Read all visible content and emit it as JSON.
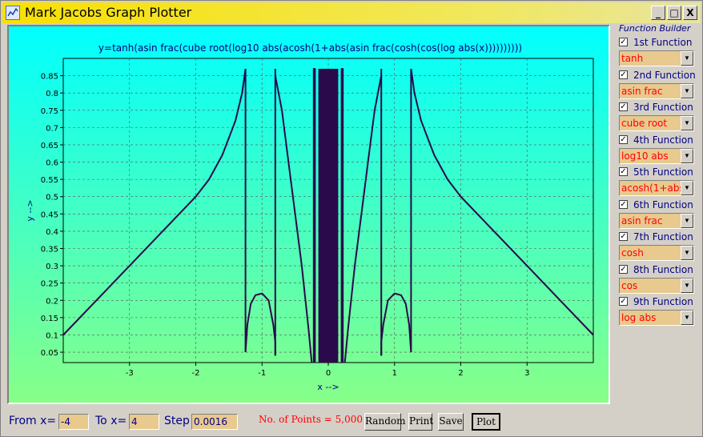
{
  "window": {
    "title": "Mark Jacobs Graph Plotter",
    "minimize": "_",
    "maximize": "□",
    "close": "X"
  },
  "plot": {
    "title": "y=tanh(asin frac(cube root(log10 abs(acosh(1+abs(asin frac(cosh(cos(log abs(x))))))))))"
  },
  "chart_data": {
    "type": "line",
    "title": "y=tanh(asin frac(cube root(log10 abs(acosh(1+abs(asin frac(cosh(cos(log abs(x))))))))))",
    "xlabel": "x -->",
    "ylabel": "y -->",
    "xlim": [
      -4,
      4
    ],
    "ylim": [
      0.02,
      0.9
    ],
    "x_ticks": [
      "-3",
      "-2",
      "-1",
      "0",
      "1",
      "2",
      "3"
    ],
    "y_ticks": [
      "0.05",
      "0.1",
      "0.15",
      "0.2",
      "0.25",
      "0.3",
      "0.35",
      "0.4",
      "0.45",
      "0.5",
      "0.55",
      "0.6",
      "0.65",
      "0.7",
      "0.75",
      "0.8",
      "0.85"
    ],
    "grid": true,
    "line_color": "#2a0a4a",
    "series": [
      {
        "x": [
          -4,
          -3.5,
          -3,
          -2.5,
          -2,
          -1.8,
          -1.6,
          -1.5,
          -1.4,
          -1.3,
          -1.25
        ],
        "y": [
          0.1,
          0.2,
          0.3,
          0.4,
          0.5,
          0.55,
          0.62,
          0.67,
          0.72,
          0.8,
          0.87
        ]
      },
      {
        "x": [
          -1.25,
          -1.25
        ],
        "y": [
          0.87,
          0.05
        ]
      },
      {
        "x": [
          -1.25,
          -1.22,
          -1.17,
          -1.1,
          -1.0,
          -0.9,
          -0.83,
          -0.8,
          -0.8
        ],
        "y": [
          0.05,
          0.13,
          0.19,
          0.215,
          0.22,
          0.2,
          0.13,
          0.08,
          0.04
        ]
      },
      {
        "x": [
          -0.8,
          -0.8
        ],
        "y": [
          0.04,
          0.87
        ]
      },
      {
        "x": [
          -0.8,
          -0.7,
          -0.6,
          -0.5,
          -0.4,
          -0.3,
          -0.25
        ],
        "y": [
          0.85,
          0.75,
          0.6,
          0.45,
          0.3,
          0.12,
          0.02
        ]
      },
      {
        "x": [
          -0.22,
          -0.22,
          -0.2,
          -0.2
        ],
        "y": [
          0.02,
          0.87,
          0.87,
          0.02
        ]
      },
      {
        "x": [
          0.2,
          0.2,
          0.22,
          0.22
        ],
        "y": [
          0.02,
          0.87,
          0.87,
          0.02
        ]
      },
      {
        "x": [
          0.25,
          0.3,
          0.4,
          0.5,
          0.6,
          0.7,
          0.8
        ],
        "y": [
          0.02,
          0.12,
          0.3,
          0.45,
          0.6,
          0.75,
          0.85
        ]
      },
      {
        "x": [
          0.8,
          0.8
        ],
        "y": [
          0.87,
          0.04
        ]
      },
      {
        "x": [
          0.8,
          0.8,
          0.83,
          0.9,
          1.0,
          1.1,
          1.17,
          1.22,
          1.25
        ],
        "y": [
          0.04,
          0.08,
          0.13,
          0.2,
          0.22,
          0.215,
          0.19,
          0.13,
          0.05
        ]
      },
      {
        "x": [
          1.25,
          1.25
        ],
        "y": [
          0.05,
          0.87
        ]
      },
      {
        "x": [
          1.25,
          1.3,
          1.4,
          1.5,
          1.6,
          1.8,
          2,
          2.5,
          3,
          3.5,
          4
        ],
        "y": [
          0.87,
          0.8,
          0.72,
          0.67,
          0.62,
          0.55,
          0.5,
          0.4,
          0.3,
          0.2,
          0.1
        ]
      }
    ],
    "dense_band": {
      "x_range": [
        -0.15,
        0.15
      ],
      "y_range": [
        0.02,
        0.87
      ]
    }
  },
  "side": {
    "title": "Function Builder",
    "functions": [
      {
        "label": "1st Function",
        "value": "tanh"
      },
      {
        "label": "2nd Function",
        "value": "asin frac"
      },
      {
        "label": "3rd Function",
        "value": "cube root"
      },
      {
        "label": "4th Function",
        "value": "log10 abs"
      },
      {
        "label": "5th Function",
        "value": "acosh(1+abs"
      },
      {
        "label": "6th Function",
        "value": "asin frac"
      },
      {
        "label": "7th Function",
        "value": "cosh"
      },
      {
        "label": "8th Function",
        "value": "cos"
      },
      {
        "label": "9th Function",
        "value": "log abs"
      }
    ]
  },
  "bottom": {
    "from_label": "From x=",
    "from_value": "-4",
    "to_label": "To x=",
    "to_value": "4",
    "step_label": "Step",
    "step_value": "0.0016",
    "points": "No. of Points = 5,000",
    "random": "Random",
    "print": "Print",
    "save": "Save",
    "plot": "Plot"
  }
}
